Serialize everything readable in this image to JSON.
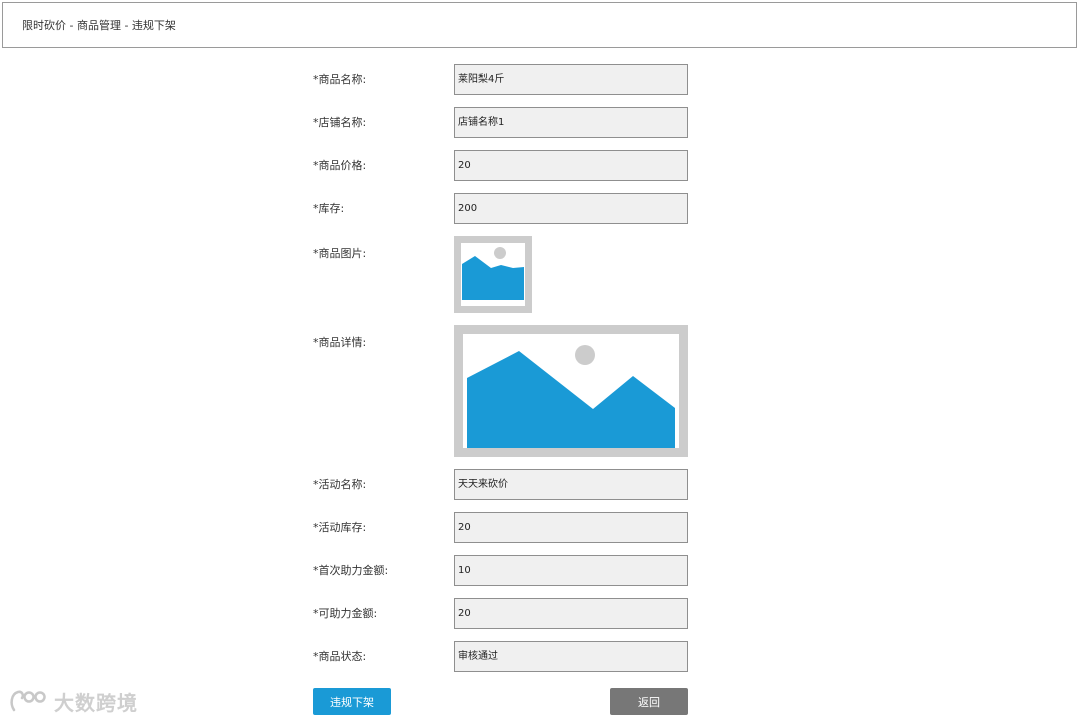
{
  "breadcrumb": {
    "text": "限时砍价 - 商品管理 - 违规下架"
  },
  "form": {
    "product_name": {
      "label": "*商品名称:",
      "value": "莱阳梨4斤"
    },
    "shop_name": {
      "label": "*店铺名称:",
      "value": "店铺名称1"
    },
    "product_price": {
      "label": "*商品价格:",
      "value": "20"
    },
    "stock": {
      "label": "*库存:",
      "value": "200"
    },
    "product_image": {
      "label": "*商品图片:",
      "icon": "image-placeholder-icon"
    },
    "product_detail": {
      "label": "*商品详情:",
      "icon": "image-placeholder-icon"
    },
    "activity_name": {
      "label": "*活动名称:",
      "value": "天天来砍价"
    },
    "activity_stock": {
      "label": "*活动库存:",
      "value": "20"
    },
    "first_help_amount": {
      "label": "*首次助力金额:",
      "value": "10"
    },
    "help_amount": {
      "label": "*可助力金额:",
      "value": "20"
    },
    "product_status": {
      "label": "*商品状态:",
      "value": "审核通过"
    }
  },
  "buttons": {
    "takedown_label": "违规下架",
    "back_label": "返回"
  },
  "watermark": {
    "text": "大数跨境"
  },
  "colors": {
    "primary": "#1a9ad6",
    "back": "#777777",
    "field_bg": "#f0f0f0",
    "placeholder_frame": "#cccccc",
    "placeholder_mountain": "#1a9ad6"
  }
}
